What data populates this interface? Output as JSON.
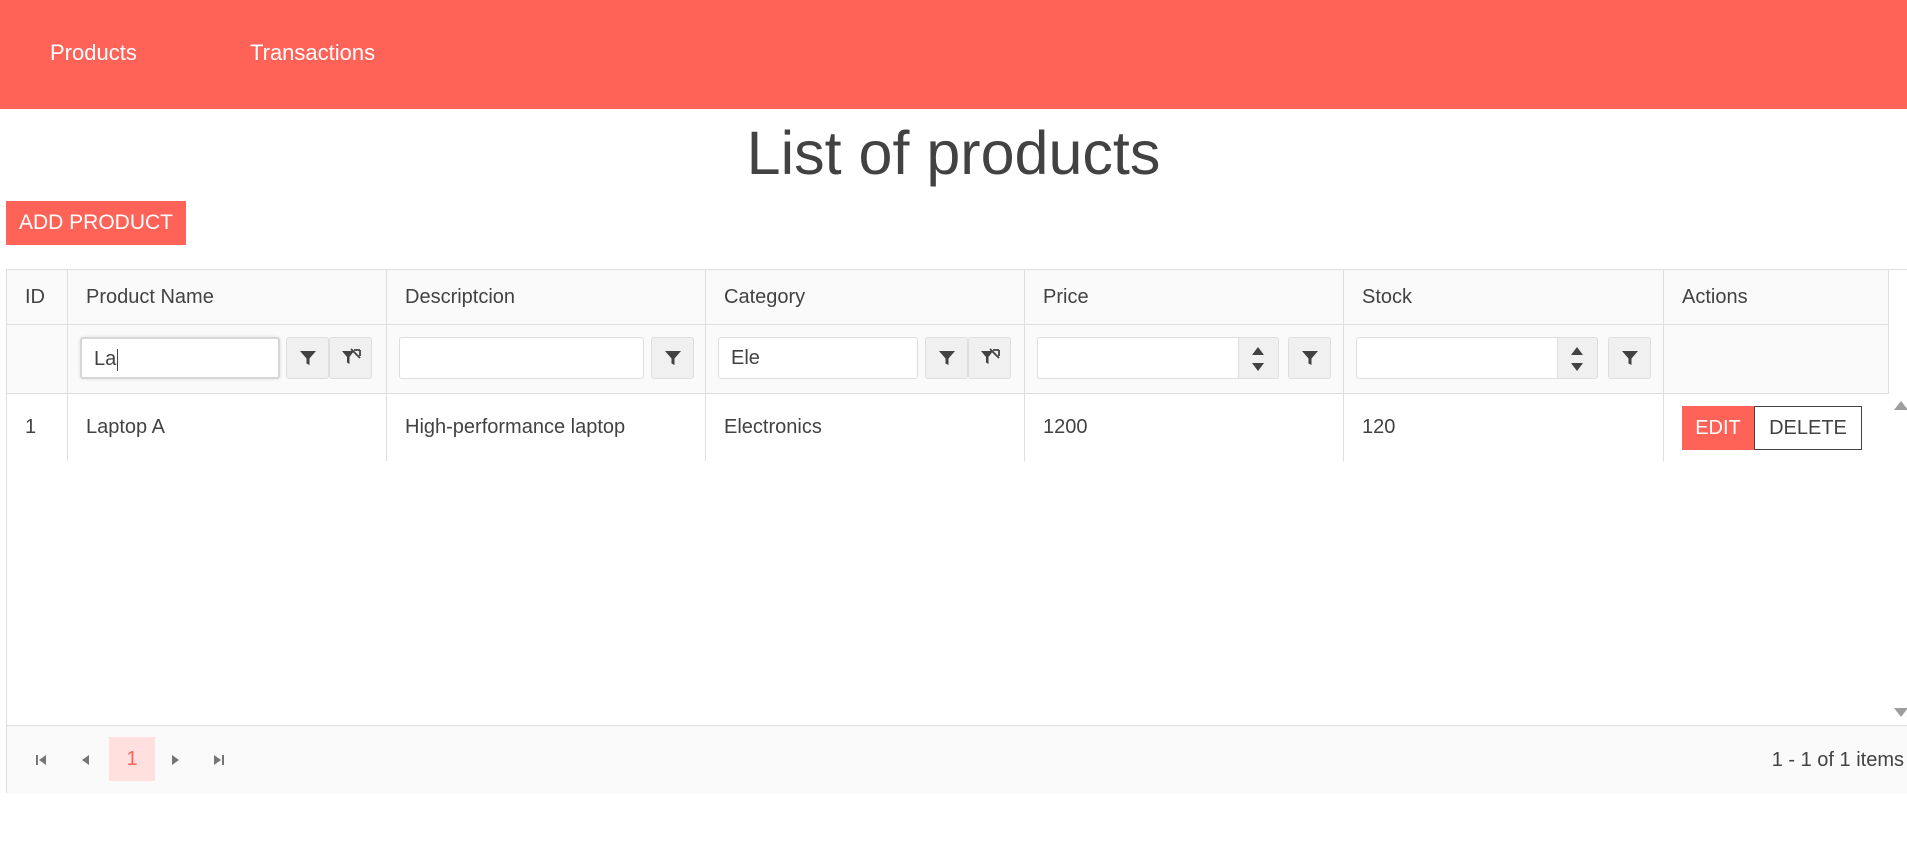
{
  "nav": {
    "products": "Products",
    "transactions": "Transactions"
  },
  "page": {
    "title": "List of products",
    "add_button": "ADD PRODUCT"
  },
  "grid": {
    "columns": [
      "ID",
      "Product Name",
      "Descriptcion",
      "Category",
      "Price",
      "Stock",
      "Actions"
    ],
    "filters": {
      "product_name": "La",
      "description": "",
      "category": "Ele",
      "price": "",
      "stock": ""
    },
    "rows": [
      {
        "id": "1",
        "name": "Laptop A",
        "description": "High-performance laptop",
        "category": "Electronics",
        "price": "1200",
        "stock": "120",
        "edit_label": "EDIT",
        "delete_label": "DELETE"
      }
    ],
    "pager": {
      "current_page": "1",
      "info": "1 - 1 of 1 items"
    }
  },
  "colors": {
    "accent": "#ff6358",
    "text": "#424242",
    "border": "#dedede"
  },
  "icons": [
    "filter-icon",
    "clear-filter-icon",
    "spin-up-icon",
    "spin-down-icon",
    "first-page-icon",
    "prev-page-icon",
    "next-page-icon",
    "last-page-icon"
  ]
}
